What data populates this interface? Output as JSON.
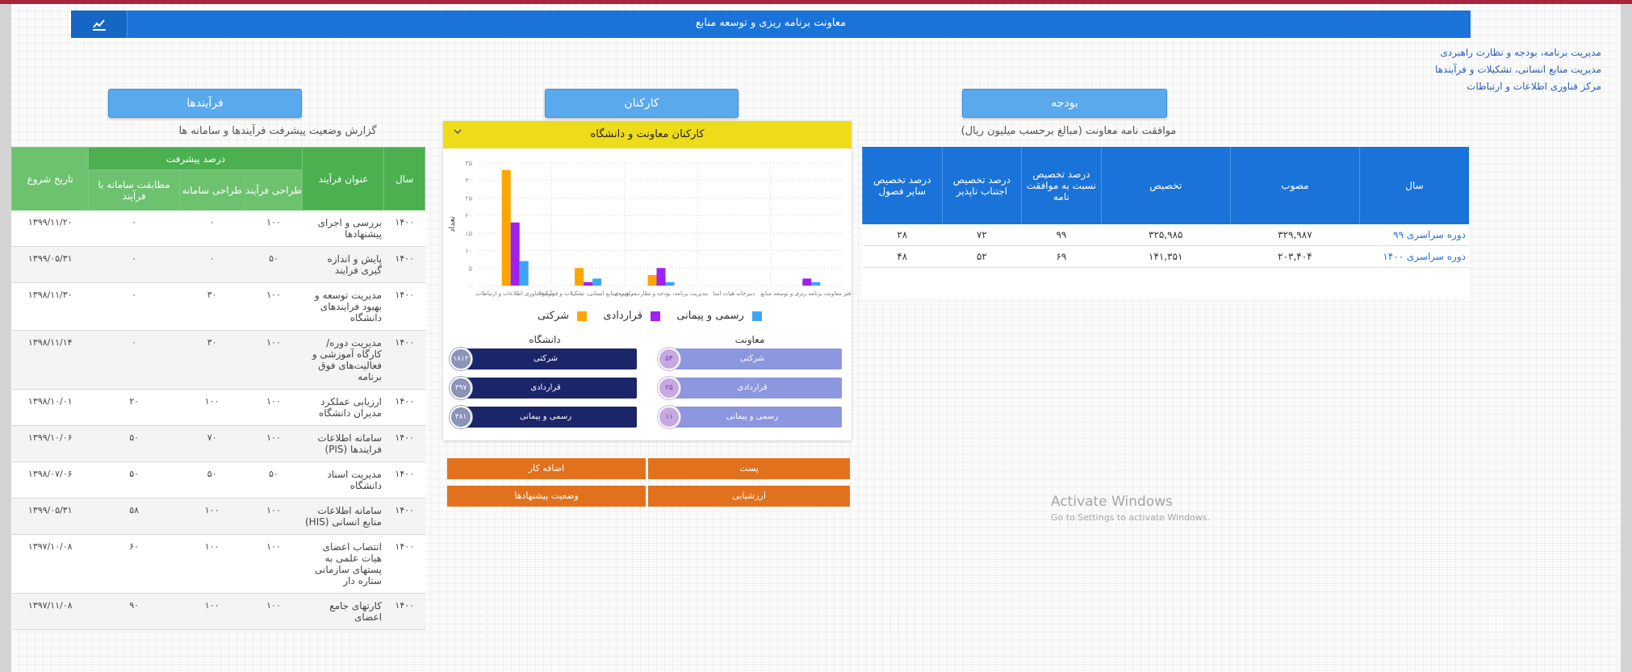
{
  "header": {
    "title": "معاونت برنامه ریزی و توسعه منابع",
    "icon": "chart-icon"
  },
  "links": [
    "مدیریت برنامه، بودجه و نظارت راهبردی",
    "مدیریت منابع انسانی، تشکیلات و فرآیندها",
    "مرکز فناوری اطلاعات و ارتباطات"
  ],
  "sections": {
    "processes": "فرآیندها",
    "staff": "کارکنان",
    "budget": "بودجه"
  },
  "processes": {
    "subtitle": "گزارش وضعیت پیشرفت فرآیندها و سامانه ها",
    "headers": {
      "year": "سال",
      "title": "عنوان فرآیند",
      "progress": "درصد پیشرفت",
      "design_process": "طراحی فرآیند",
      "design_system": "طراحی سامانه",
      "match": "مطابقت سامانه با فرآیند",
      "start": "تاریخ شروع"
    },
    "rows": [
      {
        "year": "۱۴۰۰",
        "title": "بررسی و اجرای پیشنهادها",
        "p1": "۱۰۰",
        "p2": "۰",
        "p3": "۰",
        "date": "۱۳۹۹/۱۱/۲۰"
      },
      {
        "year": "۱۴۰۰",
        "title": "پایش و اندازه گیری فرایند",
        "p1": "۵۰",
        "p2": "۰",
        "p3": "۰",
        "date": "۱۳۹۹/۰۵/۳۱"
      },
      {
        "year": "۱۴۰۰",
        "title": "مدیریت توسعه و بهبود فرایندهای دانشگاه",
        "p1": "۱۰۰",
        "p2": "۳۰",
        "p3": "۰",
        "date": "۱۳۹۸/۱۱/۳۰"
      },
      {
        "year": "۱۴۰۰",
        "title": "مدیریت دوره/ کارگاه آموزشی و فعالیت‌های فوق برنامه",
        "p1": "۱۰۰",
        "p2": "۳۰",
        "p3": "۰",
        "date": "۱۳۹۸/۱۱/۱۴"
      },
      {
        "year": "۱۴۰۰",
        "title": "ارزیابی عملکرد مدیران دانشگاه",
        "p1": "۱۰۰",
        "p2": "۱۰۰",
        "p3": "۲۰",
        "date": "۱۳۹۸/۱۰/۰۱"
      },
      {
        "year": "۱۴۰۰",
        "title": "سامانه اطلاعات فرایندها (PIS)",
        "p1": "۱۰۰",
        "p2": "۷۰",
        "p3": "۵۰",
        "date": "۱۳۹۹/۱۰/۰۶"
      },
      {
        "year": "۱۴۰۰",
        "title": "مدیریت اسناد دانشگاه",
        "p1": "۵۰",
        "p2": "۵۰",
        "p3": "۵۰",
        "date": "۱۳۹۸/۰۷/۰۶"
      },
      {
        "year": "۱۴۰۰",
        "title": "سامانه اطلاعات منابع انسانی (HIS)",
        "p1": "۱۰۰",
        "p2": "۱۰۰",
        "p3": "۵۸",
        "date": "۱۳۹۹/۰۵/۳۱"
      },
      {
        "year": "۱۴۰۰",
        "title": "انتصاب اعضای هیات علمی به پستهای سازمانی ستاره دار",
        "p1": "۱۰۰",
        "p2": "۱۰۰",
        "p3": "۶۰",
        "date": "۱۳۹۷/۱۰/۰۸"
      },
      {
        "year": "۱۴۰۰",
        "title": "کارتهای جامع اعضای",
        "p1": "۱۰۰",
        "p2": "۱۰۰",
        "p3": "۹۰",
        "date": "۱۳۹۷/۱۱/۰۸"
      }
    ]
  },
  "staff_panel": {
    "title": "کارکنان معاونت و دانشگاه",
    "legend": [
      "رسمی و پیمانی",
      "قراردادی",
      "شرکتی"
    ],
    "university": {
      "label": "دانشگاه",
      "items": [
        {
          "label": "شرکتی",
          "value": "۱۸۱۲"
        },
        {
          "label": "قراردادی",
          "value": "۳۹۷"
        },
        {
          "label": "رسمی و پیمانی",
          "value": "۳۸۱"
        }
      ]
    },
    "deputy": {
      "label": "معاونت",
      "items": [
        {
          "label": "شرکتی",
          "value": "۵۴"
        },
        {
          "label": "قراردادی",
          "value": "۲۵"
        },
        {
          "label": "رسمی و پیمانی",
          "value": "۱۱"
        }
      ]
    }
  },
  "chart_data": {
    "type": "bar",
    "ylabel": "تعداد",
    "ylim": [
      0,
      35
    ],
    "yticks": [
      "۰",
      "۵",
      "۱۰",
      "۱۵",
      "۲۰",
      "۲۵",
      "۳۰",
      "۳۵"
    ],
    "categories": [
      "مرکز فناوری اطلاعات و ارتباطات",
      "مدیریت منابع انسانی، تشکیلات و فرآیندها",
      "مدیریت برنامه، بودجه و نظارت راهبردی",
      "دبیرخانه هیات امنا",
      "دفتر معاونت برنامه ریزی و توسعه منابع"
    ],
    "series": [
      {
        "name": "شرکتی",
        "color": "#ffa500",
        "values": [
          33,
          5,
          3,
          0,
          0
        ]
      },
      {
        "name": "قراردادی",
        "color": "#a020f0",
        "values": [
          18,
          1,
          5,
          0,
          2
        ]
      },
      {
        "name": "رسمی و پیمانی",
        "color": "#3da5f5",
        "values": [
          7,
          2,
          1,
          0,
          1
        ]
      }
    ],
    "grid": true,
    "legend": "bottom"
  },
  "buttons": {
    "post": "پست",
    "add_work": "اضافه کار",
    "evaluation": "ارزشیابی",
    "suggestions": "وضعیت پیشنهادها"
  },
  "budget": {
    "subtitle": "موافقت نامه معاونت (مبالغ برحسب میلیون ریال)",
    "headers": [
      "سال",
      "مصوب",
      "تخصیص",
      "درصد تخصیص نسبت به موافقت نامه",
      "درصد تخصیص اجتناب ناپذیر",
      "درصد تخصیص سایر فصول"
    ],
    "rows": [
      [
        "دوره سراسری ۹۹",
        "۳۲۹,۹۸۷",
        "۳۲۵,۹۸۵",
        "۹۹",
        "۷۲",
        "۲۸"
      ],
      [
        "دوره سراسری ۱۴۰۰",
        "۲۰۳,۴۰۴",
        "۱۴۱,۳۵۱",
        "۶۹",
        "۵۲",
        "۴۸"
      ]
    ]
  },
  "watermark": {
    "line1": "Activate Windows",
    "line2": "Go to Settings to activate Windows."
  }
}
